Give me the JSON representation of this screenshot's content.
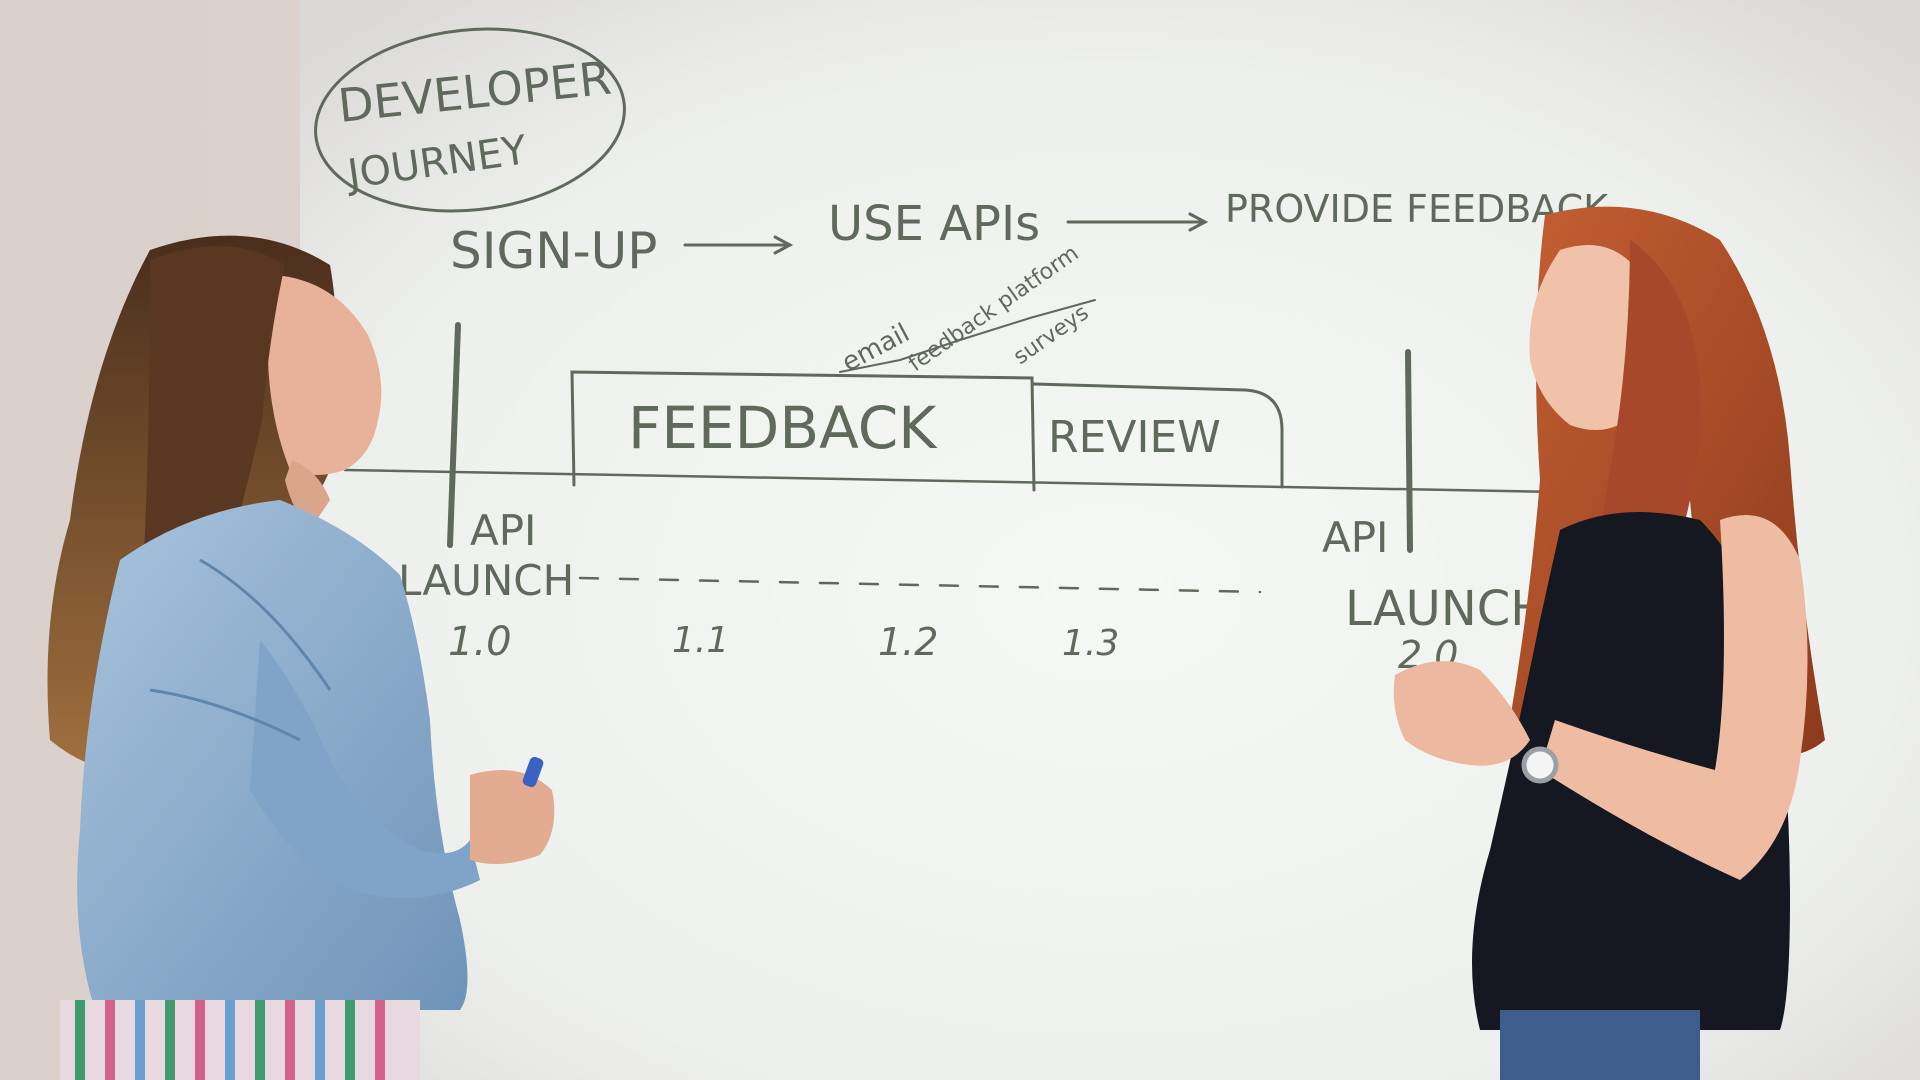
{
  "whiteboard": {
    "title_line1": "DEVELOPER",
    "title_line2": "JOURNEY",
    "flow": {
      "step1": "SIGN-UP",
      "step2": "USE APIs",
      "step3": "PROVIDE FEEDBACK"
    },
    "phases": {
      "feedback": "FEEDBACK",
      "review": "REVIEW"
    },
    "scribbles": {
      "a": "email",
      "b": "feedback platform",
      "c": "surveys"
    },
    "launch_left_line1": "API",
    "launch_left_line2": "LAUNCH",
    "launch_right_line1": "API",
    "launch_right_line2": "LAUNCH",
    "versions": [
      "1.0",
      "1.1",
      "1.2",
      "1.3",
      "2.0"
    ]
  },
  "colors": {
    "wall": "#e9e3df",
    "board": "#f0f2ef",
    "marker": "#5f6a5c",
    "denim": "#8fb1d1",
    "auburn_hair": "#b3532c",
    "brown_hair": "#6b4528",
    "black_top": "#161821",
    "skin": "#e9b8a0"
  }
}
